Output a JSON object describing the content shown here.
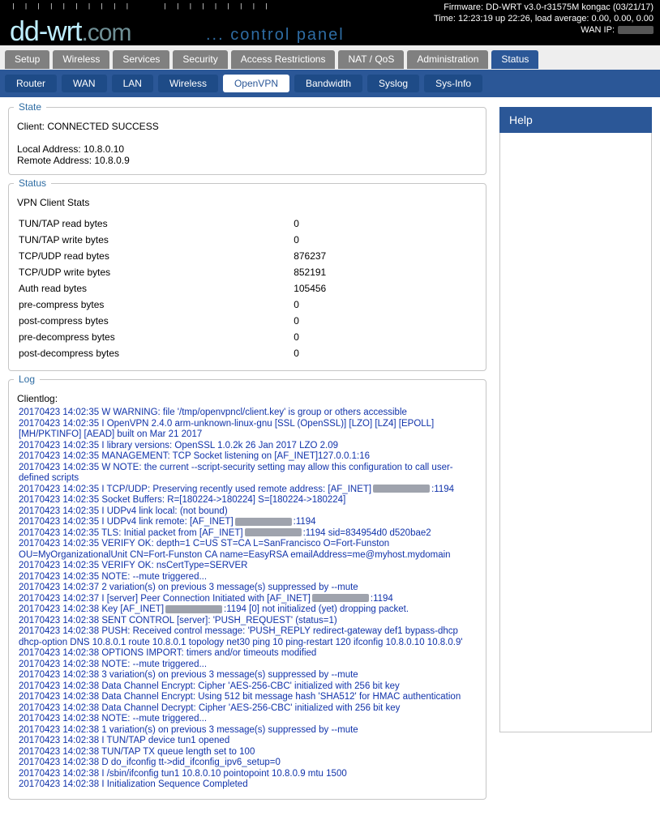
{
  "header": {
    "firmware": "Firmware: DD-WRT v3.0-r31575M kongac (03/21/17)",
    "time": "Time: 12:23:19 up 22:26, load average: 0.00, 0.00, 0.00",
    "wan_label": "WAN IP:",
    "brand_main": "dd-wrt",
    "brand_suffix": ".com",
    "cpanel": "... control panel"
  },
  "tabs": {
    "items": [
      "Setup",
      "Wireless",
      "Services",
      "Security",
      "Access Restrictions",
      "NAT / QoS",
      "Administration",
      "Status"
    ],
    "active_index": 7
  },
  "subtabs": {
    "items": [
      "Router",
      "WAN",
      "LAN",
      "Wireless",
      "OpenVPN",
      "Bandwidth",
      "Syslog",
      "Sys-Info"
    ],
    "active_index": 4
  },
  "help": {
    "title": "Help"
  },
  "state": {
    "legend": "State",
    "client_line": "Client: CONNECTED SUCCESS",
    "local_addr": "Local Address: 10.8.0.10",
    "remote_addr": "Remote Address: 10.8.0.9"
  },
  "status": {
    "legend": "Status",
    "section_title": "VPN Client Stats",
    "rows": [
      {
        "k": "TUN/TAP read bytes",
        "v": "0"
      },
      {
        "k": "TUN/TAP write bytes",
        "v": "0"
      },
      {
        "k": "TCP/UDP read bytes",
        "v": "876237"
      },
      {
        "k": "TCP/UDP write bytes",
        "v": "852191"
      },
      {
        "k": "Auth read bytes",
        "v": "105456"
      },
      {
        "k": "pre-compress bytes",
        "v": "0"
      },
      {
        "k": "post-compress bytes",
        "v": "0"
      },
      {
        "k": "pre-decompress bytes",
        "v": "0"
      },
      {
        "k": "post-decompress bytes",
        "v": "0"
      }
    ]
  },
  "log": {
    "legend": "Log",
    "title": "Clientlog:",
    "lines": [
      {
        "t": "20170423 14:02:35 W WARNING: file '/tmp/openvpncl/client.key' is group or others accessible"
      },
      {
        "t": "20170423 14:02:35 I OpenVPN 2.4.0 arm-unknown-linux-gnu [SSL (OpenSSL)] [LZO] [LZ4] [EPOLL] [MH/PKTINFO] [AEAD] built on Mar 21 2017"
      },
      {
        "t": "20170423 14:02:35 I library versions: OpenSSL 1.0.2k 26 Jan 2017 LZO 2.09"
      },
      {
        "t": "20170423 14:02:35 MANAGEMENT: TCP Socket listening on [AF_INET]127.0.0.1:16"
      },
      {
        "t": "20170423 14:02:35 W NOTE: the current --script-security setting may allow this configuration to call user-defined scripts"
      },
      {
        "t": "20170423 14:02:35 I TCP/UDP: Preserving recently used remote address: [AF_INET]",
        "mask": true,
        "after": ":1194"
      },
      {
        "t": "20170423 14:02:35 Socket Buffers: R=[180224->180224] S=[180224->180224]"
      },
      {
        "t": "20170423 14:02:35 I UDPv4 link local: (not bound)"
      },
      {
        "t": "20170423 14:02:35 I UDPv4 link remote: [AF_INET]",
        "mask": true,
        "after": ":1194"
      },
      {
        "t": "20170423 14:02:35 TLS: Initial packet from [AF_INET]",
        "mask": true,
        "after": ":1194 sid=834954d0 d520bae2"
      },
      {
        "t": "20170423 14:02:35 VERIFY OK: depth=1 C=US ST=CA L=SanFrancisco O=Fort-Funston OU=MyOrganizationalUnit CN=Fort-Funston CA name=EasyRSA emailAddress=me@myhost.mydomain"
      },
      {
        "t": "20170423 14:02:35 VERIFY OK: nsCertType=SERVER"
      },
      {
        "t": "20170423 14:02:35 NOTE: --mute triggered..."
      },
      {
        "t": "20170423 14:02:37 2 variation(s) on previous 3 message(s) suppressed by --mute"
      },
      {
        "t": "20170423 14:02:37 I [server] Peer Connection Initiated with [AF_INET]",
        "mask": true,
        "after": ":1194"
      },
      {
        "t": "20170423 14:02:38 Key [AF_INET]",
        "mask": true,
        "after": ":1194 [0] not initialized (yet) dropping packet."
      },
      {
        "t": "20170423 14:02:38 SENT CONTROL [server]: 'PUSH_REQUEST' (status=1)"
      },
      {
        "t": "20170423 14:02:38 PUSH: Received control message: 'PUSH_REPLY redirect-gateway def1 bypass-dhcp dhcp-option DNS 10.8.0.1 route 10.8.0.1 topology net30 ping 10 ping-restart 120 ifconfig 10.8.0.10 10.8.0.9'"
      },
      {
        "t": "20170423 14:02:38 OPTIONS IMPORT: timers and/or timeouts modified"
      },
      {
        "t": "20170423 14:02:38 NOTE: --mute triggered..."
      },
      {
        "t": "20170423 14:02:38 3 variation(s) on previous 3 message(s) suppressed by --mute"
      },
      {
        "t": "20170423 14:02:38 Data Channel Encrypt: Cipher 'AES-256-CBC' initialized with 256 bit key"
      },
      {
        "t": "20170423 14:02:38 Data Channel Encrypt: Using 512 bit message hash 'SHA512' for HMAC authentication"
      },
      {
        "t": "20170423 14:02:38 Data Channel Decrypt: Cipher 'AES-256-CBC' initialized with 256 bit key"
      },
      {
        "t": "20170423 14:02:38 NOTE: --mute triggered..."
      },
      {
        "t": "20170423 14:02:38 1 variation(s) on previous 3 message(s) suppressed by --mute"
      },
      {
        "t": "20170423 14:02:38 I TUN/TAP device tun1 opened"
      },
      {
        "t": "20170423 14:02:38 TUN/TAP TX queue length set to 100"
      },
      {
        "t": "20170423 14:02:38 D do_ifconfig tt->did_ifconfig_ipv6_setup=0"
      },
      {
        "t": "20170423 14:02:38 I /sbin/ifconfig tun1 10.8.0.10 pointopoint 10.8.0.9 mtu 1500"
      },
      {
        "t": "20170423 14:02:38 I Initialization Sequence Completed"
      }
    ]
  }
}
